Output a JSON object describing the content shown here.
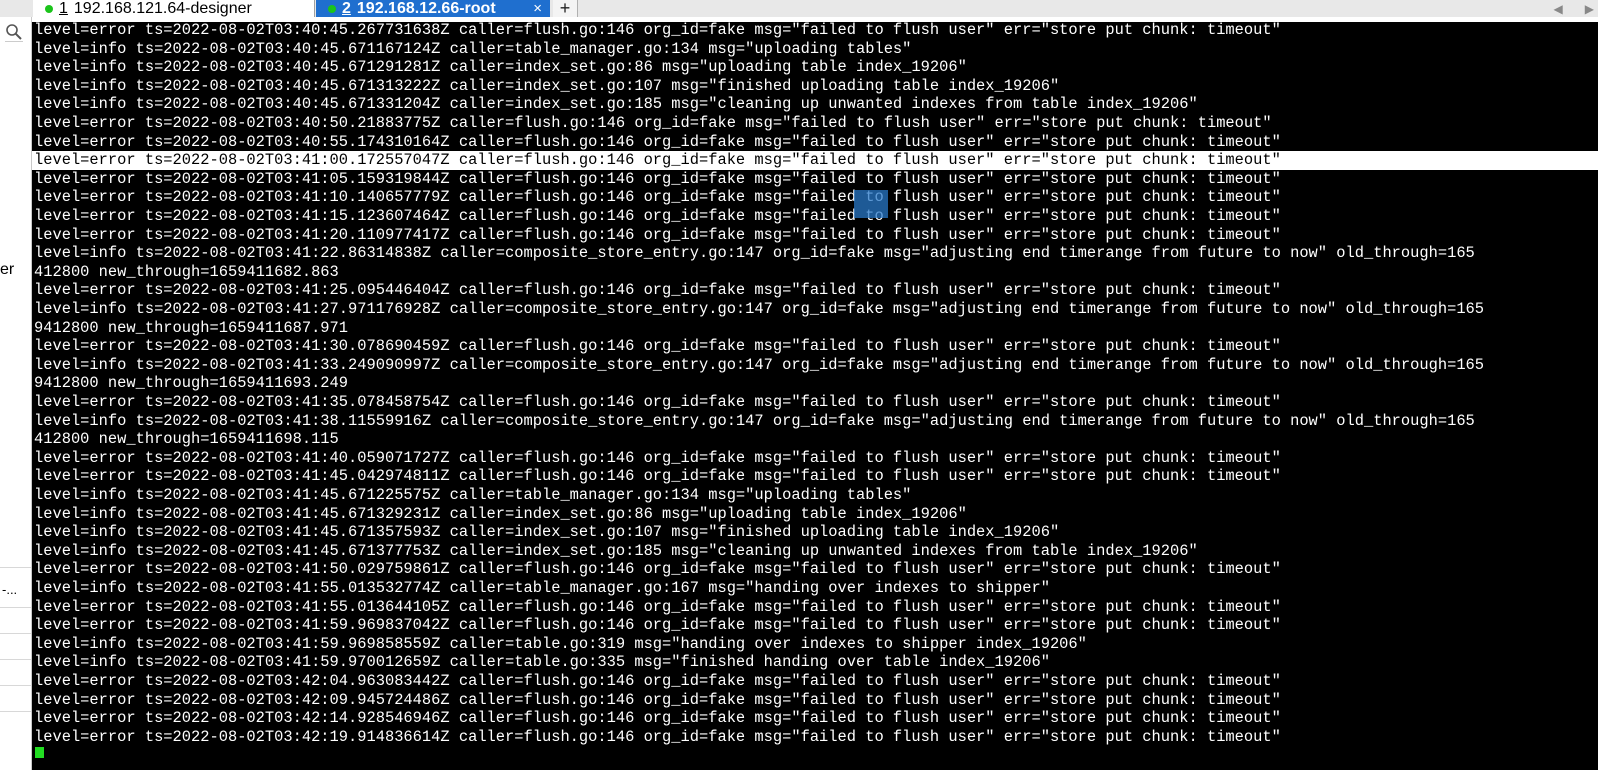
{
  "tabs": [
    {
      "number": "1",
      "label": "192.168.121.64-designer",
      "active": false
    },
    {
      "number": "2",
      "label": "192.168.12.66-root",
      "active": true
    }
  ],
  "tab_close": "×",
  "new_tab": "+",
  "tab_nav": {
    "left": "◀",
    "right": "▶"
  },
  "sidebar": {
    "fragment_1": "er",
    "fragment_2": "-..."
  },
  "colors": {
    "active_tab": "#1f6fcf",
    "status_dot": "#1bc41b",
    "terminal_bg": "#000000",
    "cursor": "#22dd22"
  },
  "terminal": {
    "lines": [
      "level=error ts=2022-08-02T03:40:45.267731638Z caller=flush.go:146 org_id=fake msg=\"failed to flush user\" err=\"store put chunk: timeout\"",
      "level=info ts=2022-08-02T03:40:45.671167124Z caller=table_manager.go:134 msg=\"uploading tables\"",
      "level=info ts=2022-08-02T03:40:45.671291281Z caller=index_set.go:86 msg=\"uploading table index_19206\"",
      "level=info ts=2022-08-02T03:40:45.671313222Z caller=index_set.go:107 msg=\"finished uploading table index_19206\"",
      "level=info ts=2022-08-02T03:40:45.671331204Z caller=index_set.go:185 msg=\"cleaning up unwanted indexes from table index_19206\"",
      "level=error ts=2022-08-02T03:40:50.21883775Z caller=flush.go:146 org_id=fake msg=\"failed to flush user\" err=\"store put chunk: timeout\"",
      "level=error ts=2022-08-02T03:40:55.174310164Z caller=flush.go:146 org_id=fake msg=\"failed to flush user\" err=\"store put chunk: timeout\"",
      "level=error ts=2022-08-02T03:41:00.172557047Z caller=flush.go:146 org_id=fake msg=\"failed to flush user\" err=\"store put chunk: timeout\"",
      "level=error ts=2022-08-02T03:41:05.159319844Z caller=flush.go:146 org_id=fake msg=\"failed to flush user\" err=\"store put chunk: timeout\"",
      "level=error ts=2022-08-02T03:41:10.140657779Z caller=flush.go:146 org_id=fake msg=\"failed to flush user\" err=\"store put chunk: timeout\"",
      "level=error ts=2022-08-02T03:41:15.123607464Z caller=flush.go:146 org_id=fake msg=\"failed to flush user\" err=\"store put chunk: timeout\"",
      "level=error ts=2022-08-02T03:41:20.110977417Z caller=flush.go:146 org_id=fake msg=\"failed to flush user\" err=\"store put chunk: timeout\"",
      "level=info ts=2022-08-02T03:41:22.86314838Z caller=composite_store_entry.go:147 org_id=fake msg=\"adjusting end timerange from future to now\" old_through=165",
      "412800 new_through=1659411682.863",
      "level=error ts=2022-08-02T03:41:25.095446404Z caller=flush.go:146 org_id=fake msg=\"failed to flush user\" err=\"store put chunk: timeout\"",
      "level=info ts=2022-08-02T03:41:27.971176928Z caller=composite_store_entry.go:147 org_id=fake msg=\"adjusting end timerange from future to now\" old_through=165",
      "9412800 new_through=1659411687.971",
      "level=error ts=2022-08-02T03:41:30.078690459Z caller=flush.go:146 org_id=fake msg=\"failed to flush user\" err=\"store put chunk: timeout\"",
      "level=info ts=2022-08-02T03:41:33.249090997Z caller=composite_store_entry.go:147 org_id=fake msg=\"adjusting end timerange from future to now\" old_through=165",
      "9412800 new_through=1659411693.249",
      "level=error ts=2022-08-02T03:41:35.078458754Z caller=flush.go:146 org_id=fake msg=\"failed to flush user\" err=\"store put chunk: timeout\"",
      "level=info ts=2022-08-02T03:41:38.11559916Z caller=composite_store_entry.go:147 org_id=fake msg=\"adjusting end timerange from future to now\" old_through=165",
      "412800 new_through=1659411698.115",
      "level=error ts=2022-08-02T03:41:40.059071727Z caller=flush.go:146 org_id=fake msg=\"failed to flush user\" err=\"store put chunk: timeout\"",
      "level=error ts=2022-08-02T03:41:45.042974811Z caller=flush.go:146 org_id=fake msg=\"failed to flush user\" err=\"store put chunk: timeout\"",
      "level=info ts=2022-08-02T03:41:45.671225575Z caller=table_manager.go:134 msg=\"uploading tables\"",
      "level=info ts=2022-08-02T03:41:45.671329231Z caller=index_set.go:86 msg=\"uploading table index_19206\"",
      "level=info ts=2022-08-02T03:41:45.671357593Z caller=index_set.go:107 msg=\"finished uploading table index_19206\"",
      "level=info ts=2022-08-02T03:41:45.671377753Z caller=index_set.go:185 msg=\"cleaning up unwanted indexes from table index_19206\"",
      "level=error ts=2022-08-02T03:41:50.029759861Z caller=flush.go:146 org_id=fake msg=\"failed to flush user\" err=\"store put chunk: timeout\"",
      "level=info ts=2022-08-02T03:41:55.013532774Z caller=table_manager.go:167 msg=\"handing over indexes to shipper\"",
      "level=error ts=2022-08-02T03:41:55.013644105Z caller=flush.go:146 org_id=fake msg=\"failed to flush user\" err=\"store put chunk: timeout\"",
      "level=error ts=2022-08-02T03:41:59.969837042Z caller=flush.go:146 org_id=fake msg=\"failed to flush user\" err=\"store put chunk: timeout\"",
      "level=info ts=2022-08-02T03:41:59.969858559Z caller=table.go:319 msg=\"handing over indexes to shipper index_19206\"",
      "level=info ts=2022-08-02T03:41:59.970012659Z caller=table.go:335 msg=\"finished handing over table index_19206\"",
      "level=error ts=2022-08-02T03:42:04.963083442Z caller=flush.go:146 org_id=fake msg=\"failed to flush user\" err=\"store put chunk: timeout\"",
      "level=error ts=2022-08-02T03:42:09.945724486Z caller=flush.go:146 org_id=fake msg=\"failed to flush user\" err=\"store put chunk: timeout\"",
      "level=error ts=2022-08-02T03:42:14.928546946Z caller=flush.go:146 org_id=fake msg=\"failed to flush user\" err=\"store put chunk: timeout\"",
      "level=error ts=2022-08-02T03:42:19.914836614Z caller=flush.go:146 org_id=fake msg=\"failed to flush user\" err=\"store put chunk: timeout\""
    ],
    "highlighted_line": 7
  }
}
